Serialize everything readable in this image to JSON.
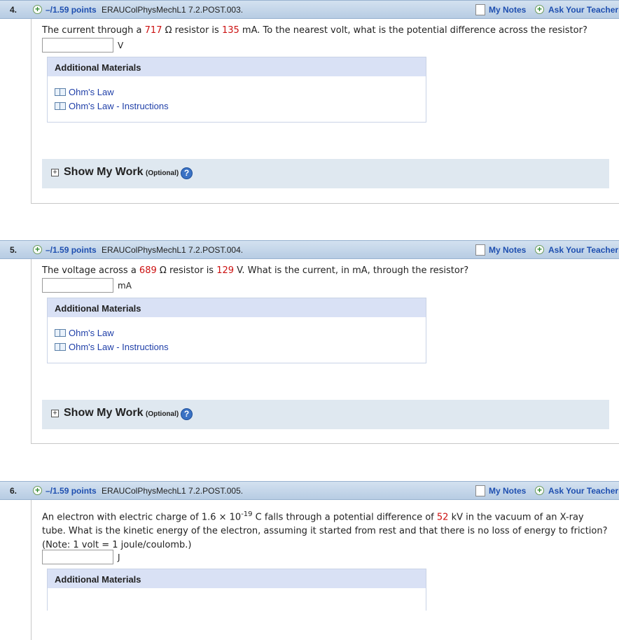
{
  "header_common": {
    "points": "–/1.59 points",
    "my_notes": "My Notes",
    "ask_teacher": "Ask Your Teacher"
  },
  "questions": [
    {
      "number": "4.",
      "id": "ERAUColPhysMechL1 7.2.POST.003.",
      "text_a": "The current through a ",
      "resistance": "717",
      "text_b": " Ω resistor is ",
      "current": "135",
      "text_c": " mA. To the nearest volt, what is the potential difference across the resistor?",
      "unit": "V"
    },
    {
      "number": "5.",
      "id": "ERAUColPhysMechL1 7.2.POST.004.",
      "text_a": "The voltage across a ",
      "resistance": "689",
      "text_b": " Ω resistor is ",
      "voltage": "129",
      "text_c": " V. What is the current, in mA, through the resistor?",
      "unit": "mA"
    },
    {
      "number": "6.",
      "id": "ERAUColPhysMechL1 7.2.POST.005.",
      "text_a": "An electron with electric charge of 1.6 × 10",
      "exponent": "-19",
      "text_b": " C falls through a potential difference of ",
      "potential": "52",
      "text_c": " kV in the vacuum of an X-ray tube. What is the kinetic energy of the electron, assuming it started from rest and that there is no loss of energy to friction? (Note: 1 volt = 1 joule/coulomb.)",
      "unit": "J"
    }
  ],
  "additional_materials": {
    "title": "Additional Materials",
    "links": [
      "Ohm's Law",
      "Ohm's Law - Instructions"
    ]
  },
  "show_work": {
    "title": "Show My Work",
    "optional": "(Optional)",
    "help": "?"
  },
  "icons": {
    "plus": "plus-circle-icon",
    "notes": "note-icon",
    "book": "book-icon",
    "expand": "expand-box-icon",
    "help": "help-icon"
  },
  "colors": {
    "header_bg": "#c4d6ea",
    "link_blue": "#1e4fb0",
    "value_red": "#cc1111",
    "materials_header": "#d9e1f5",
    "show_work_bg": "#dfe8f0"
  }
}
